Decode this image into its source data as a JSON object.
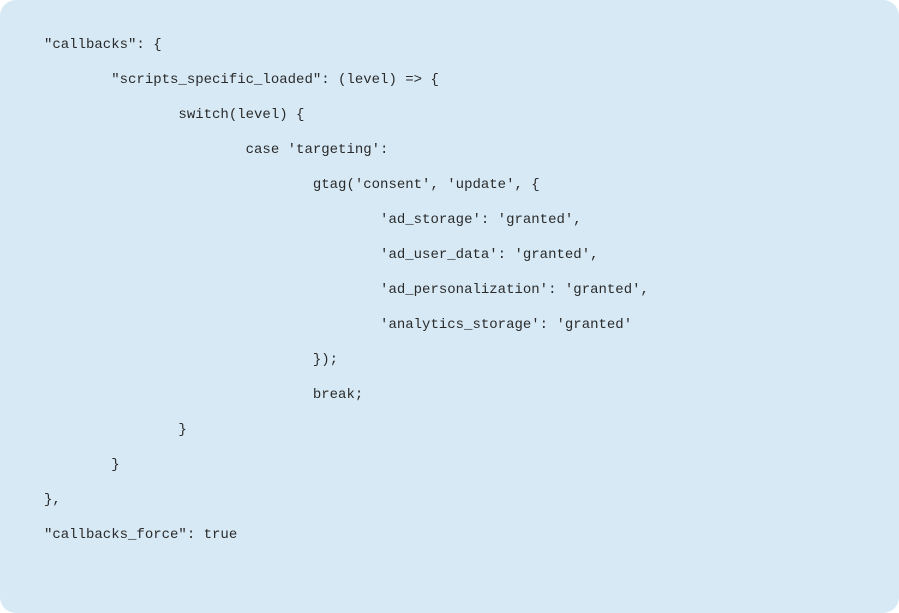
{
  "code": {
    "lines": [
      "\"callbacks\": {",
      "        \"scripts_specific_loaded\": (level) => {",
      "                switch(level) {",
      "                        case 'targeting':",
      "                                gtag('consent', 'update', {",
      "                                        'ad_storage': 'granted',",
      "                                        'ad_user_data': 'granted',",
      "                                        'ad_personalization': 'granted',",
      "                                        'analytics_storage': 'granted'",
      "                                });",
      "                                break;",
      "                }",
      "        }",
      "},",
      "\"callbacks_force\": true"
    ]
  }
}
